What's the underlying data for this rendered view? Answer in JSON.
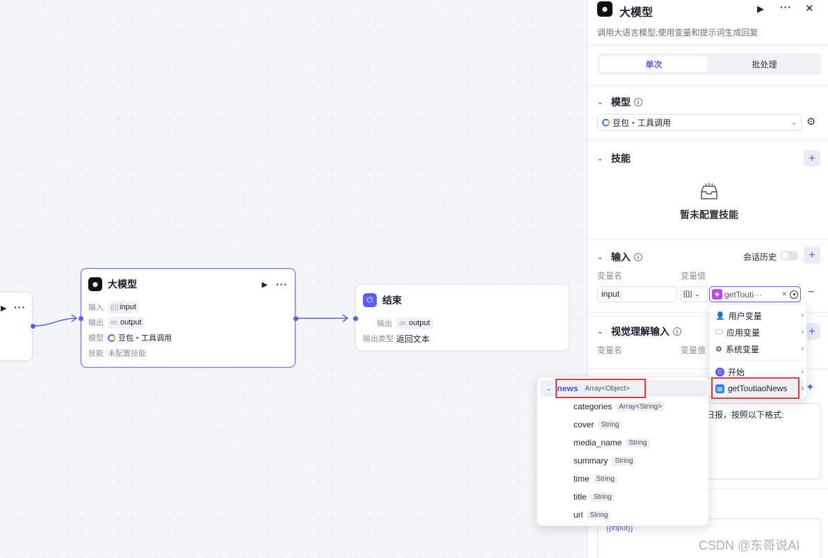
{
  "canvas": {
    "left_node": {
      "play_icon": "▶",
      "more_icon": "···"
    },
    "llm_node": {
      "title": "大模型",
      "play_icon": "▶",
      "more_icon": "···",
      "rows": {
        "input_key": "输入",
        "input_pre": "[{}]",
        "input_val": "input",
        "output_key": "输出",
        "output_pre": "str.",
        "output_val": "output",
        "model_key": "模型",
        "model_val": "豆包・工具调用",
        "skill_key": "技能",
        "skill_val": "未配置技能"
      }
    },
    "end_node": {
      "title": "结束",
      "output_key": "输出",
      "output_pre": "str.",
      "output_val": "output",
      "type_key": "输出类型",
      "type_val": "返回文本"
    }
  },
  "panel": {
    "title": "大模型",
    "subtitle": "调用大语言模型,使用变量和提示词生成回复",
    "play_icon": "▶",
    "more_icon": "···",
    "close_icon": "✕",
    "tabs": [
      "单次",
      "批处理"
    ],
    "model_section": {
      "title": "模型",
      "selected": "豆包・工具调用"
    },
    "skill_section": {
      "title": "技能",
      "empty_text": "暂未配置技能"
    },
    "input_section": {
      "title": "输入",
      "history_label": "会话历史",
      "col_name": "变量名",
      "col_value": "变量值",
      "row": {
        "name": "input",
        "type": "[{}]",
        "ref": "getTouti···"
      }
    },
    "vision_section": {
      "title": "视觉理解输入",
      "col_name": "变量名",
      "col_value": "变量值"
    },
    "prompt_partial": "日报，按照以下格式:",
    "prompt_var": "{{input}}"
  },
  "var_menu": {
    "items": [
      "用户变量",
      "应用变量",
      "系统变量"
    ],
    "nodes": [
      "开始",
      "getToutiaoNews"
    ]
  },
  "field_menu": {
    "root": {
      "name": "news",
      "type": "Array<Object>"
    },
    "children": [
      {
        "name": "categories",
        "type": "Array<String>"
      },
      {
        "name": "cover",
        "type": "String"
      },
      {
        "name": "media_name",
        "type": "String"
      },
      {
        "name": "summary",
        "type": "String"
      },
      {
        "name": "time",
        "type": "String"
      },
      {
        "name": "title",
        "type": "String"
      },
      {
        "name": "url",
        "type": "String"
      }
    ]
  },
  "watermark": "CSDN @东哥说AI",
  "colors": {
    "accent": "#5a5ef0",
    "highlight": "#e03a3a"
  }
}
